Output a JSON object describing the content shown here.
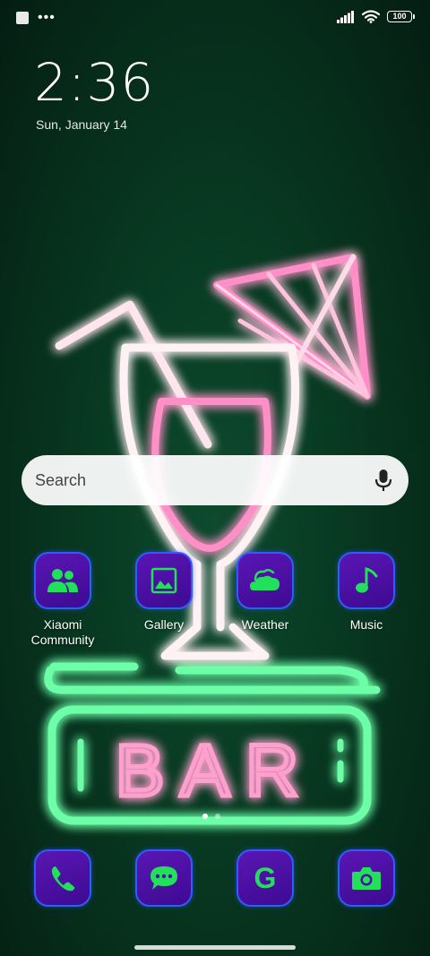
{
  "status_bar": {
    "battery": "100"
  },
  "clock": {
    "time": "2:36",
    "date": "Sun, January 14"
  },
  "search": {
    "placeholder": "Search"
  },
  "wallpaper": {
    "text": "BAR"
  },
  "apps": [
    {
      "label": "Xiaomi Community",
      "icon": "community-icon"
    },
    {
      "label": "Gallery",
      "icon": "gallery-icon"
    },
    {
      "label": "Weather",
      "icon": "weather-icon"
    },
    {
      "label": "Music",
      "icon": "music-icon"
    }
  ],
  "dock": [
    {
      "icon": "phone-icon"
    },
    {
      "icon": "messages-icon"
    },
    {
      "icon": "google-icon",
      "glyph": "G"
    },
    {
      "icon": "camera-icon"
    }
  ],
  "colors": {
    "icon_bg": "#4a0fa3",
    "icon_glyph": "#22e05a",
    "icon_border": "#2f5cff",
    "neon_pink": "#ff7fbf",
    "neon_green": "#6dffa8"
  },
  "page_indicator": {
    "pages": 2,
    "current": 1
  }
}
